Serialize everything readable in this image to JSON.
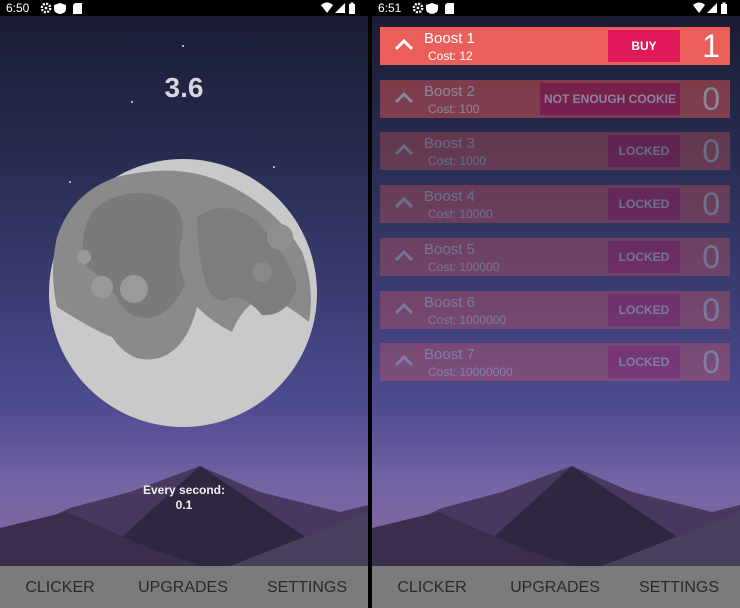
{
  "left_screen": {
    "status": {
      "time": "6:50"
    },
    "score": "3.6",
    "rate_label": "Every second:",
    "rate_value": "0.1",
    "nav": {
      "clicker": "CLICKER",
      "upgrades": "UPGRADES",
      "settings": "SETTINGS"
    }
  },
  "right_screen": {
    "status": {
      "time": "6:51"
    },
    "boosts": [
      {
        "name": "Boost 1",
        "cost": "Cost: 12",
        "button": "BUY",
        "count": "1"
      },
      {
        "name": "Boost 2",
        "cost": "Cost: 100",
        "button": "NOT ENOUGH COOKIE",
        "count": "0"
      },
      {
        "name": "Boost 3",
        "cost": "Cost: 1000",
        "button": "LOCKED",
        "count": "0"
      },
      {
        "name": "Boost 4",
        "cost": "Cost: 10000",
        "button": "LOCKED",
        "count": "0"
      },
      {
        "name": "Boost 5",
        "cost": "Cost: 100000",
        "button": "LOCKED",
        "count": "0"
      },
      {
        "name": "Boost 6",
        "cost": "Cost: 1000000",
        "button": "LOCKED",
        "count": "0"
      },
      {
        "name": "Boost 7",
        "cost": "Cost: 10000000",
        "button": "LOCKED",
        "count": "0"
      }
    ],
    "nav": {
      "clicker": "CLICKER",
      "upgrades": "UPGRADES",
      "settings": "SETTINGS"
    }
  },
  "icons": [
    "gear-icon",
    "shield-icon",
    "sd-card-icon",
    "wifi-icon",
    "signal-icon",
    "battery-icon",
    "chevron-up-icon",
    "moon-icon"
  ],
  "colors": {
    "boost_row": "#eb5f5a",
    "buy_button": "#e0195a",
    "navbar": "#7b7b7b"
  }
}
